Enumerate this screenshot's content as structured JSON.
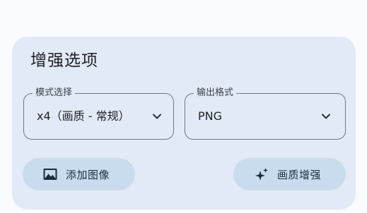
{
  "panel": {
    "title": "增强选项"
  },
  "mode_select": {
    "label": "模式选择",
    "value": "x4（画质 - 常规）",
    "icon": "chevron-down-icon"
  },
  "format_select": {
    "label": "输出格式",
    "value": "PNG",
    "icon": "chevron-down-icon"
  },
  "buttons": {
    "add_image": {
      "label": "添加图像",
      "icon": "image-icon"
    },
    "enhance": {
      "label": "画质增强",
      "icon": "sparkle-icon"
    }
  },
  "colors": {
    "page_background": "#fafbfe",
    "card_background": "#e1eaf6",
    "button_background": "#c9dcee",
    "outline": "#6f7682",
    "text": "#1f1f1f"
  }
}
